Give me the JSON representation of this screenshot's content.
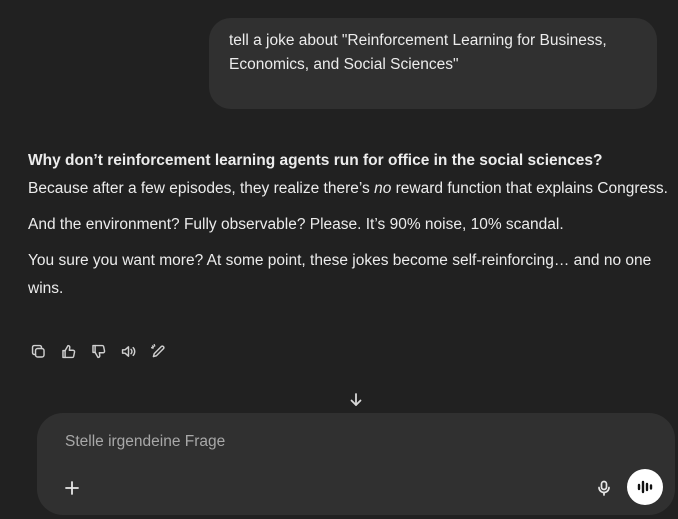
{
  "user_message": {
    "line1": "tell a joke about \"Reinforcement Learning for Business,",
    "line2": "Economics, and Social Sciences\""
  },
  "assistant_message": {
    "question": "Why don’t reinforcement learning agents run for office in the social sciences?",
    "answer_before": "Because after a few episodes, they realize there’s ",
    "answer_emphasis": "no",
    "answer_after": " reward function that explains Congress.",
    "paragraph2": "And the environment? Fully observable? Please. It’s 90% noise, 10% scandal.",
    "paragraph3": "You sure you want more? At some point, these jokes become self-reinforcing… and no one wins."
  },
  "message_actions": {
    "icons": [
      "copy-icon",
      "thumbs-up-icon",
      "thumbs-down-icon",
      "read-aloud-icon",
      "edit-icon"
    ]
  },
  "composer": {
    "placeholder": "Stelle irgendeine Frage",
    "value": "",
    "icons": [
      "plus-icon",
      "microphone-icon",
      "voice-mode-icon"
    ]
  },
  "scroll": {
    "icon": "arrow-down-icon"
  },
  "colors": {
    "background": "#212121",
    "bubble": "#303030",
    "text": "#ececec",
    "placeholder": "#a8a8a8",
    "voice_button": "#ffffff"
  }
}
